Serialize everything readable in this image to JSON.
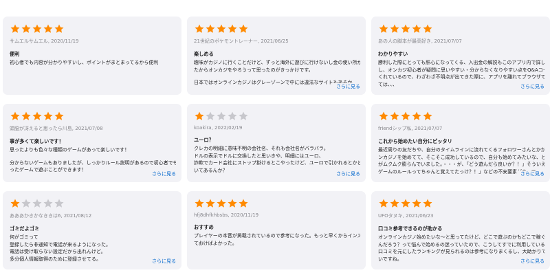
{
  "colors": {
    "star_filled": "#ff8a00",
    "star_empty": "#c7c7cc",
    "link": "#0066cc",
    "card_bg": "#f2f2f6"
  },
  "more_label": "さらに見る",
  "reviews": [
    {
      "rating": 5,
      "meta": "サムエルサムエル, 2020/11/19",
      "title": "便利",
      "lines": [
        "初心者でも内容が分かりやすいし、ポイントがまとまってるから便利"
      ],
      "has_more": false
    },
    {
      "rating": 5,
      "meta": "21世紀のポケモントレーナー, 2021/06/25",
      "title": "楽しめる",
      "lines": [
        "趣味がカジノに行くことだけど、ずっと海外に遊びに行けないし金の使い所がなかっ",
        "たからオンカジをやろうって思ったのがきっかけです。",
        "",
        "日本ではオンラインカジノはグレーゾーンで中には違法なサイトもあるか"
      ],
      "has_more": true
    },
    {
      "rating": 5,
      "meta": "あの人の脚本が最高好き, 2021/07/07",
      "title": "わかりやすい",
      "lines": [
        "勝利した際にとっても肝心になってくる、入出金の解説もこのアプリ内で詳しく知れる",
        "し、オンカジ初心者が疑問に思いやすい・分からなくなりやすい点をQ&Aコーナーにまとめて",
        "くれているので、わざわざ不明点が出てきた際に、アプリを離れてブラウザで調べなく",
        "ては、、、"
      ],
      "has_more": true
    },
    {
      "rating": 5,
      "meta": "頭脳が冴えると思ったら川島, 2021/07/08",
      "title": "事が多くて楽しいです！",
      "lines": [
        "思ったよりも色々な種類のゲームがあって楽しいです！",
        "",
        "分からないゲームもありましたが、しっかりルール説明があるので初心者でも気にな",
        "ったゲームで遊ぶことができます！"
      ],
      "has_more": true
    },
    {
      "rating": 1,
      "meta": "koakira, 2022/02/19",
      "title": "ユーロ？",
      "lines": [
        "クレカの明細に意味不明の会社名、それも会社名がバラバラ。",
        "ドルの表示でドルに交換したと思いきや、明細にはユーロ、",
        "詐欺でカード会社にストップ掛けるとこやったけど、ユーロで引かれるとかどっかに書",
        "いてあるんか？"
      ],
      "has_more": true
    },
    {
      "rating": 5,
      "meta": "friendシップ私, 2021/07/07",
      "title": "これから始めたい自分にピッタリ",
      "lines": [
        "最近周りの友だちや、自分のタイムラインに流れてくるフォロワーさんとかがオンライ",
        "ンカジノを始めてて、そこそこ成功しているので、自分も始めてみたいな、という気持ち",
        "がムクムク膨らんでいました。・・・が、「どう遊んだら良いか？！」そういえばテーブル",
        "ゲームのルールってちゃんと覚えてたっけ？！」などの不安要素があって"
      ],
      "has_more": true
    },
    {
      "rating": 1,
      "meta": "あああかきかなききは6, 2021/08/12",
      "title": "ゴミだよゴミ",
      "lines": [
        "何がゴミって",
        "登録したら非通知で電話が来るようになった。",
        "電話は受け取らない設定だから出れんけど。",
        "多分個人情報取得のために登録させてる。"
      ],
      "has_more": true
    },
    {
      "rating": 5,
      "meta": "hfj8dhfkhbsbs, 2020/11/19",
      "title": "おすすめ",
      "lines": [
        "プレイヤーの本音が掲載されているので参考になった。もっと早くからインストールし",
        "ておけばよかった。"
      ],
      "has_more": false
    },
    {
      "rating": 5,
      "meta": "UFOタヌキ, 2021/06/23",
      "title": "口コミ参考できるのが助かる",
      "lines": [
        "オンラインカジノ始めたいな〜と思ってたけど、どこで遊ぶのかもどこで稼ぐのが良い",
        "んだろう？って悩んで始めるの迷っていたので、こうしてすでに利用している皆さんの",
        "口コミを元にしたランキングが見られるのは参考になりまくるし、大助かりでしかな",
        "いですね。"
      ],
      "has_more": true
    }
  ]
}
